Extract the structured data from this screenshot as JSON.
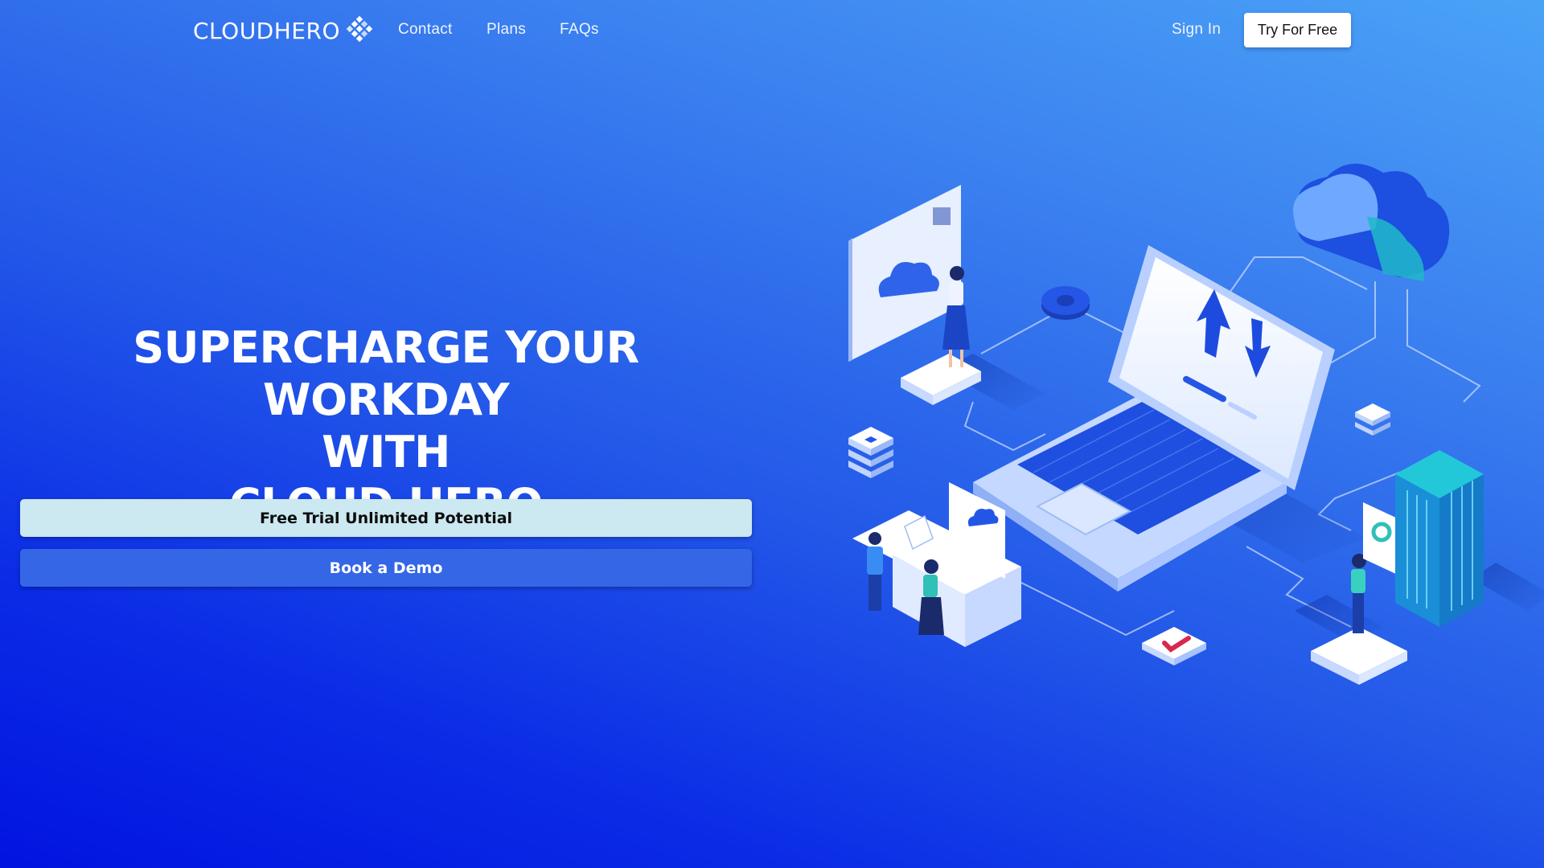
{
  "nav": {
    "logo_text": "CLOUDHERO",
    "links": [
      "Contact",
      "Plans",
      "FAQs"
    ],
    "sign_in": "Sign In",
    "try_free": "Try For Free"
  },
  "hero": {
    "title_line1": "SUPERCHARGE YOUR WORKDAY",
    "title_line2": "WITH",
    "title_line3": "CLOUD HERO",
    "primary_button": "Free Trial Unlimited Potential",
    "secondary_button": "Book a Demo"
  },
  "colors": {
    "background_top": "#4aa3f7",
    "background_bottom": "#0214e0",
    "trial_button": "#cce8f0",
    "demo_button": "#3566e6"
  },
  "icons": [
    "logo-diamond-icon",
    "laptop-illustration",
    "cloud-icon",
    "gear-icon",
    "server-rack-icon",
    "checkmark-icon"
  ]
}
